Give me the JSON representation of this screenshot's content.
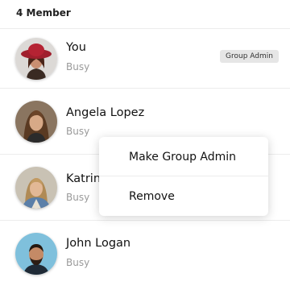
{
  "header": {
    "member_count": "4 Member"
  },
  "members": [
    {
      "name": "You",
      "status": "Busy",
      "badge": "Group Admin",
      "avatar": "avatar-woman-red-hat"
    },
    {
      "name": "Angela Lopez",
      "status": "Busy",
      "avatar": "avatar-woman-long-hair"
    },
    {
      "name": "Katrin",
      "status": "Busy",
      "avatar": "avatar-woman-denim-jacket"
    },
    {
      "name": "John Logan",
      "status": "Busy",
      "avatar": "avatar-man-beard"
    }
  ],
  "context_menu": {
    "items": [
      {
        "label": "Make Group Admin"
      },
      {
        "label": "Remove"
      }
    ]
  },
  "colors": {
    "badge_bg": "#e6e6e6",
    "status_text": "#9a9a9a",
    "divider": "#ececec"
  }
}
